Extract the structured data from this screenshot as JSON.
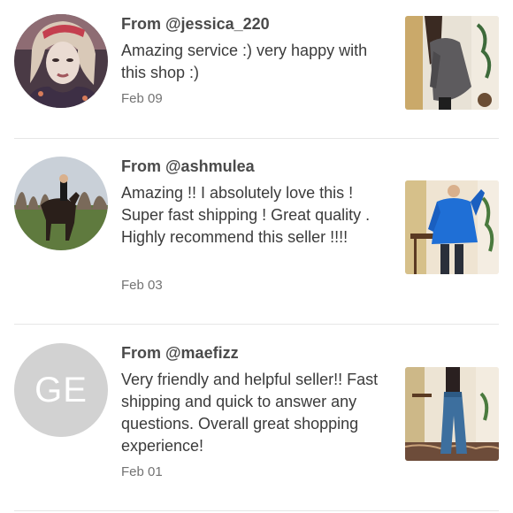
{
  "reviews": [
    {
      "from": "From @jessica_220",
      "text": "Amazing service :) very happy with this shop :)",
      "date": "Feb 09",
      "avatar": "photo",
      "product_image": "grey-sweater-photo"
    },
    {
      "from": "From @ashmulea",
      "text": "Amazing !! I absolutely love this ! Super fast shipping ! Great quality . Highly recommend this seller !!!!",
      "date": "Feb 03",
      "avatar": "photo",
      "product_image": "blue-pullover-photo"
    },
    {
      "from": "From @maefizz",
      "text": "Very friendly and helpful seller!! Fast shipping and quick to answer any questions. Overall great shopping experience!",
      "date": "Feb 01",
      "avatar_initials": "GE",
      "product_image": "flare-jeans-photo"
    }
  ],
  "colors": {
    "initials_avatar_bg": "#d2d2d2",
    "divider": "#e6e6e6",
    "text": "#3b3b3b",
    "date": "#737373"
  }
}
